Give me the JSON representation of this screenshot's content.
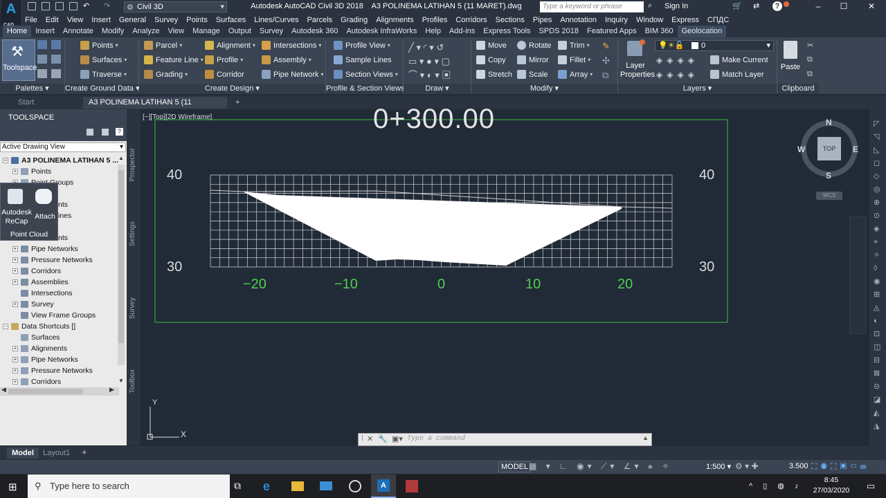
{
  "app": {
    "logo": "A",
    "logo_sub": "CAD",
    "title": "Autodesk AutoCAD Civil 3D 2018    A3 POLINEMA LATIHAN 5 (11 MARET).dwg",
    "workspace": "Civil 3D",
    "search_placeholder": "Type a keyword or phrase",
    "sign_in": "Sign In"
  },
  "menu": [
    "File",
    "Edit",
    "View",
    "Insert",
    "General",
    "Survey",
    "Points",
    "Surfaces",
    "Lines/Curves",
    "Parcels",
    "Grading",
    "Alignments",
    "Profiles",
    "Corridors",
    "Sections",
    "Pipes",
    "Annotation",
    "Inquiry",
    "Window",
    "Express",
    "СПДС"
  ],
  "ribbon_tabs": [
    "Home",
    "Insert",
    "Annotate",
    "Modify",
    "Analyze",
    "View",
    "Manage",
    "Output",
    "Survey",
    "Autodesk 360",
    "Autodesk InfraWorks",
    "Help",
    "Add-ins",
    "Express Tools",
    "SPDS 2018",
    "Featured Apps",
    "BIM 360",
    "Geolocation"
  ],
  "ribbon": {
    "toolspace": "Toolspace",
    "ground": [
      "Points",
      "Surfaces",
      "Traverse"
    ],
    "design1": [
      "Parcel",
      "Feature Line",
      "Grading"
    ],
    "design2": [
      "Alignment",
      "Profile",
      "Corridor"
    ],
    "design3": [
      "Intersections",
      "Assembly",
      "Pipe Network"
    ],
    "profsec": [
      "Profile View",
      "Sample Lines",
      "Section Views"
    ],
    "modify1": [
      "Move",
      "Copy",
      "Stretch"
    ],
    "modify2": [
      "Rotate",
      "Mirror",
      "Scale"
    ],
    "modify3": [
      "Trim",
      "Fillet",
      "Array"
    ],
    "layer_props": "Layer Properties",
    "layer_name": "0",
    "layer_cmds": [
      "Make Current",
      "Match Layer"
    ],
    "paste": "Paste",
    "panels": [
      "Palettes",
      "Create Ground Data",
      "Create Design",
      "Profile & Section Views",
      "Draw",
      "Modify",
      "Layers",
      "Clipboard"
    ]
  },
  "doc_tabs": [
    "Start",
    "A3 POLINEMA LATIHAN 5 (11 MARET)*"
  ],
  "toolspace": {
    "header": "TOOLSPACE",
    "view": "Active Drawing View",
    "root": "A3 POLINEMA LATIHAN 5 ...",
    "items": [
      "Points",
      "Point Groups",
      "nts",
      "ines",
      "nts",
      "Pipe Networks",
      "Pressure Networks",
      "Corridors",
      "Assemblies",
      "Intersections",
      "Survey",
      "View Frame Groups"
    ],
    "shortcuts": "Data Shortcuts []",
    "shortcut_items": [
      "Surfaces",
      "Alignments",
      "Pipe Networks",
      "Pressure Networks",
      "Corridors"
    ],
    "popup": {
      "recap": "Autodesk ReCap",
      "attach": "Attach",
      "title": "Point Cloud"
    },
    "sidetabs": [
      "Prospector",
      "Settings",
      "Survey",
      "Toolbox"
    ]
  },
  "viewport": {
    "label": "[−][Top][2D Wireframe]",
    "station": "0+300.00",
    "left_labels": [
      "40",
      "30"
    ],
    "right_labels": [
      "40",
      "30"
    ],
    "offsets": [
      "−20",
      "−10",
      "0",
      "10",
      "20"
    ],
    "compass": {
      "n": "N",
      "s": "S",
      "e": "E",
      "w": "W",
      "top": "TOP",
      "wcs": "WCS"
    },
    "ucs": {
      "x": "X",
      "y": "Y"
    }
  },
  "command": {
    "placeholder": "Type a command"
  },
  "layout_tabs": [
    "Model",
    "Layout1"
  ],
  "status": {
    "model": "MODEL",
    "scale": "1:500",
    "value": "3.500"
  },
  "taskbar": {
    "search": "Type here to search",
    "time": "8:45",
    "date": "27/03/2020"
  }
}
